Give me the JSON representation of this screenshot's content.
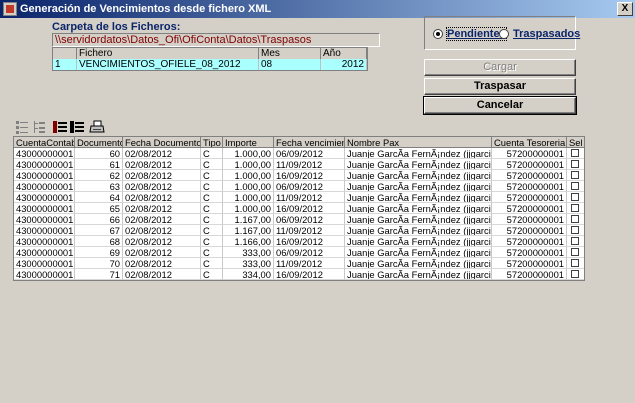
{
  "window": {
    "title": "Generación de Vencimientos desde fichero XML",
    "close_label": "X"
  },
  "folder": {
    "label": "Carpeta de los Ficheros:",
    "path": "\\\\servidordatos\\Datos_Ofi\\OfiConta\\Datos\\Traspasos"
  },
  "file_grid": {
    "headers": [
      "",
      "Fichero",
      "Mes",
      "Año"
    ],
    "rows": [
      [
        "1",
        "VENCIMIENTOS_OFIELE_08_2012",
        "08",
        "2012"
      ]
    ]
  },
  "filter": {
    "options": [
      {
        "label": "Pendientes",
        "checked": true
      },
      {
        "label": "Traspasados",
        "checked": false
      }
    ]
  },
  "buttons": {
    "cargar": "Cargar",
    "traspasar": "Traspasar",
    "cancelar": "Cancelar"
  },
  "toolbar": {
    "icons": [
      "tree-collapse-icon",
      "tree-expand-icon",
      "select-all-icon",
      "deselect-all-icon",
      "print-icon"
    ]
  },
  "table": {
    "headers": [
      "CuentaContable",
      "Documento",
      "Fecha Documento",
      "Tipo",
      "Importe",
      "Fecha vencimiento",
      "Nombre Pax",
      "Cuenta Tesoreria",
      "Sel"
    ],
    "rows": [
      [
        "43000000001",
        "60",
        "02/08/2012",
        "C",
        "1.000,00",
        "06/09/2012",
        "Juanje GarcÃ­a FernÃ¡ndez (jjgarcia@ofi.es)",
        "57200000001"
      ],
      [
        "43000000001",
        "61",
        "02/08/2012",
        "C",
        "1.000,00",
        "11/09/2012",
        "Juanje GarcÃ­a FernÃ¡ndez (jjgarcia@ofi.es)",
        "57200000001"
      ],
      [
        "43000000001",
        "62",
        "02/08/2012",
        "C",
        "1.000,00",
        "16/09/2012",
        "Juanje GarcÃ­a FernÃ¡ndez (jjgarcia@ofi.es)",
        "57200000001"
      ],
      [
        "43000000001",
        "63",
        "02/08/2012",
        "C",
        "1.000,00",
        "06/09/2012",
        "Juanje GarcÃ­a FernÃ¡ndez (jjgarcia@ofi.es)",
        "57200000001"
      ],
      [
        "43000000001",
        "64",
        "02/08/2012",
        "C",
        "1.000,00",
        "11/09/2012",
        "Juanje GarcÃ­a FernÃ¡ndez (jjgarcia@ofi.es)",
        "57200000001"
      ],
      [
        "43000000001",
        "65",
        "02/08/2012",
        "C",
        "1.000,00",
        "16/09/2012",
        "Juanje GarcÃ­a FernÃ¡ndez (jjgarcia@ofi.es)",
        "57200000001"
      ],
      [
        "43000000001",
        "66",
        "02/08/2012",
        "C",
        "1.167,00",
        "06/09/2012",
        "Juanje GarcÃ­a FernÃ¡ndez (jjgarcia@ofi.es)",
        "57200000001"
      ],
      [
        "43000000001",
        "67",
        "02/08/2012",
        "C",
        "1.167,00",
        "11/09/2012",
        "Juanje GarcÃ­a FernÃ¡ndez (jjgarcia@ofi.es)",
        "57200000001"
      ],
      [
        "43000000001",
        "68",
        "02/08/2012",
        "C",
        "1.166,00",
        "16/09/2012",
        "Juanje GarcÃ­a FernÃ¡ndez (jjgarcia@ofi.es)",
        "57200000001"
      ],
      [
        "43000000001",
        "69",
        "02/08/2012",
        "C",
        "333,00",
        "06/09/2012",
        "Juanje GarcÃ­a FernÃ¡ndez (jjgarcia@ofi.es)",
        "57200000001"
      ],
      [
        "43000000001",
        "70",
        "02/08/2012",
        "C",
        "333,00",
        "11/09/2012",
        "Juanje GarcÃ­a FernÃ¡ndez (jjgarcia@ofi.es)",
        "57200000001"
      ],
      [
        "43000000001",
        "71",
        "02/08/2012",
        "C",
        "334,00",
        "16/09/2012",
        "Juanje GarcÃ­a FernÃ¡ndez (jjgarcia@ofi.es)",
        "57200000001"
      ]
    ]
  }
}
